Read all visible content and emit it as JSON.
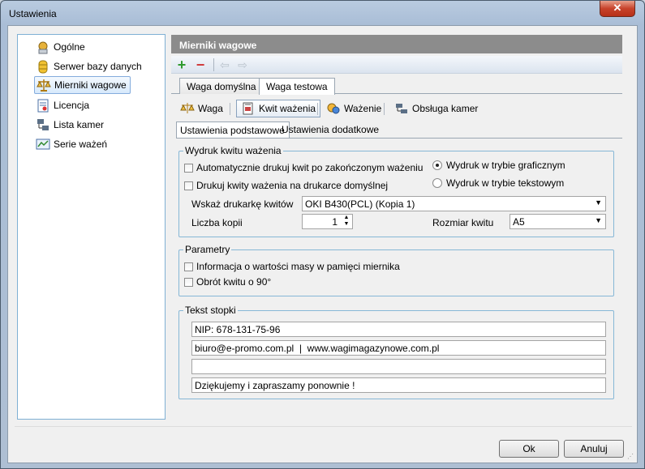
{
  "window": {
    "title": "Ustawienia",
    "close_glyph": "✕"
  },
  "nav": {
    "items": [
      {
        "label": "Ogólne",
        "icon": "general-icon"
      },
      {
        "label": "Serwer bazy danych",
        "icon": "database-icon"
      },
      {
        "label": "Mierniki wagowe",
        "icon": "scale-icon",
        "selected": true
      },
      {
        "label": "Licencja",
        "icon": "license-icon"
      },
      {
        "label": "Lista kamer",
        "icon": "camera-list-icon"
      },
      {
        "label": "Serie ważeń",
        "icon": "weighing-series-icon"
      }
    ]
  },
  "panel": {
    "title": "Mierniki wagowe",
    "toolbar": {
      "add_icon": "plus-icon",
      "remove_icon": "minus-icon",
      "back_icon": "arrow-left-icon",
      "forward_icon": "arrow-right-icon"
    },
    "scale_tabs": [
      "Waga domyślna",
      "Waga testowa"
    ],
    "active_scale_tab": "Waga testowa",
    "subtools": [
      {
        "label": "Waga",
        "icon": "scale-icon"
      },
      {
        "label": "Kwit ważenia",
        "icon": "receipt-icon",
        "active": true
      },
      {
        "label": "Ważenie",
        "icon": "weighing-icon"
      },
      {
        "label": "Obsługa kamer",
        "icon": "camera-icon"
      }
    ],
    "settings_tabs": [
      "Ustawienia podstawowe",
      "Ustawienia dodatkowe"
    ]
  },
  "print_group": {
    "legend": "Wydruk kwitu ważenia",
    "auto_print": {
      "label": "Automatycznie drukuj kwit po zakończonym ważeniu",
      "checked": false
    },
    "default_printer": {
      "label": "Drukuj kwity ważenia na drukarce domyślnej",
      "checked": false
    },
    "mode_graphic": {
      "label": "Wydruk w trybie graficznym",
      "selected": true
    },
    "mode_text": {
      "label": "Wydruk w trybie tekstowym",
      "selected": false
    },
    "printer_label": "Wskaż drukarkę kwitów",
    "printer_value": "OKI B430(PCL) (Kopia 1)",
    "copies_label": "Liczba kopii",
    "copies_value": "1",
    "size_label": "Rozmiar kwitu",
    "size_value": "A5"
  },
  "params_group": {
    "legend": "Parametry",
    "mass_info": {
      "label": "Informacja o wartości masy w pamięci miernika",
      "checked": false
    },
    "rotate": {
      "label": "Obrót kwitu o 90°",
      "checked": false
    }
  },
  "footer_group": {
    "legend": "Tekst stopki",
    "lines": [
      "NIP: 678-131-75-96",
      "biuro@e-promo.com.pl  |  www.wagimagazynowe.com.pl",
      "",
      "Dziękujemy i zapraszamy ponownie !"
    ]
  },
  "buttons": {
    "ok": "Ok",
    "cancel": "Anuluj"
  }
}
